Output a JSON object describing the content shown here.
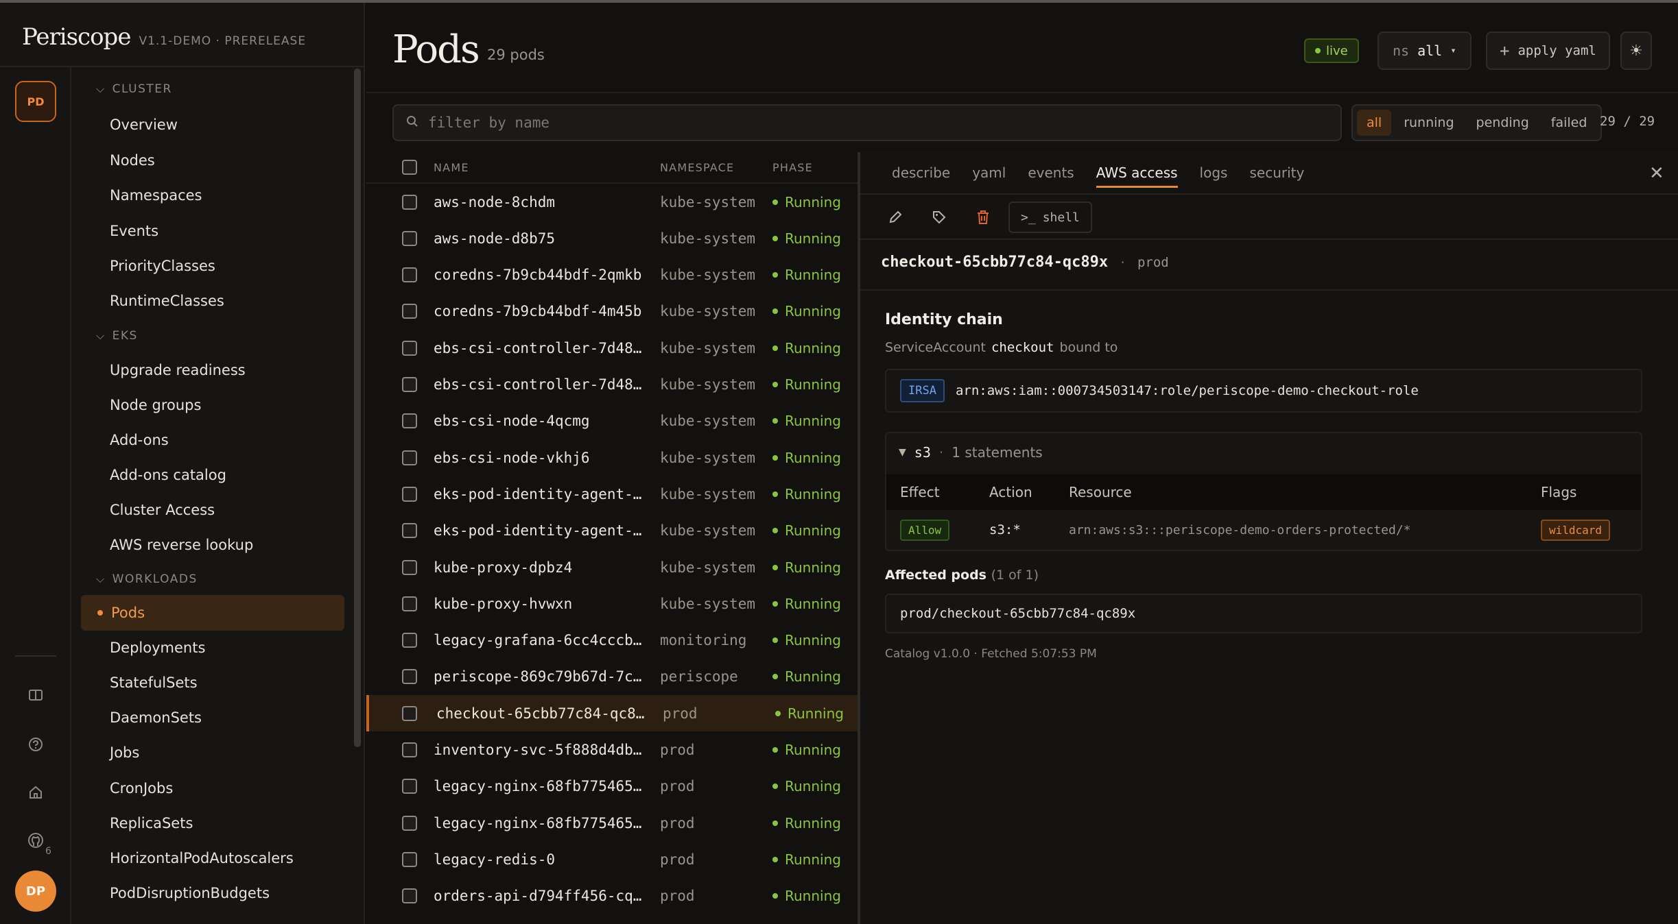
{
  "app": {
    "brand": "Periscope",
    "version": "V1.1-DEMO · PRERELEASE"
  },
  "rail": {
    "context_badge": "PD",
    "github_count": "6",
    "avatar": "DP",
    "icons": [
      "book-icon",
      "help-icon",
      "home-icon",
      "github-icon"
    ]
  },
  "nav": {
    "sections": [
      {
        "label": "CLUSTER",
        "items": [
          "Overview",
          "Nodes",
          "Namespaces",
          "Events",
          "PriorityClasses",
          "RuntimeClasses"
        ]
      },
      {
        "label": "EKS",
        "items": [
          "Upgrade readiness",
          "Node groups",
          "Add-ons",
          "Add-ons catalog",
          "Cluster Access",
          "AWS reverse lookup"
        ]
      },
      {
        "label": "WORKLOADS",
        "items": [
          "Pods",
          "Deployments",
          "StatefulSets",
          "DaemonSets",
          "Jobs",
          "CronJobs",
          "ReplicaSets",
          "HorizontalPodAutoscalers",
          "PodDisruptionBudgets"
        ]
      }
    ],
    "active": "Pods"
  },
  "header": {
    "title": "Pods",
    "count": "29 pods",
    "live": "live",
    "ns_label": "ns",
    "ns_value": "all",
    "apply": "apply yaml"
  },
  "search": {
    "placeholder": "filter by name"
  },
  "filters": {
    "options": [
      "all",
      "running",
      "pending",
      "failed"
    ],
    "active": "all",
    "pager": "29 / 29"
  },
  "table": {
    "headers": {
      "name": "NAME",
      "namespace": "NAMESPACE",
      "phase": "PHASE"
    },
    "rows": [
      {
        "name": "aws-node-8chdm",
        "ns": "kube-system",
        "phase": "Running"
      },
      {
        "name": "aws-node-d8b75",
        "ns": "kube-system",
        "phase": "Running"
      },
      {
        "name": "coredns-7b9cb44bdf-2qmkb",
        "ns": "kube-system",
        "phase": "Running"
      },
      {
        "name": "coredns-7b9cb44bdf-4m45b",
        "ns": "kube-system",
        "phase": "Running"
      },
      {
        "name": "ebs-csi-controller-7d48…",
        "ns": "kube-system",
        "phase": "Running"
      },
      {
        "name": "ebs-csi-controller-7d48…",
        "ns": "kube-system",
        "phase": "Running"
      },
      {
        "name": "ebs-csi-node-4qcmg",
        "ns": "kube-system",
        "phase": "Running"
      },
      {
        "name": "ebs-csi-node-vkhj6",
        "ns": "kube-system",
        "phase": "Running"
      },
      {
        "name": "eks-pod-identity-agent-…",
        "ns": "kube-system",
        "phase": "Running"
      },
      {
        "name": "eks-pod-identity-agent-…",
        "ns": "kube-system",
        "phase": "Running"
      },
      {
        "name": "kube-proxy-dpbz4",
        "ns": "kube-system",
        "phase": "Running"
      },
      {
        "name": "kube-proxy-hvwxn",
        "ns": "kube-system",
        "phase": "Running"
      },
      {
        "name": "legacy-grafana-6cc4cccb…",
        "ns": "monitoring",
        "phase": "Running"
      },
      {
        "name": "periscope-869c79b67d-7c…",
        "ns": "periscope",
        "phase": "Running"
      },
      {
        "name": "checkout-65cbb77c84-qc8…",
        "ns": "prod",
        "phase": "Running",
        "selected": true
      },
      {
        "name": "inventory-svc-5f888d4db…",
        "ns": "prod",
        "phase": "Running"
      },
      {
        "name": "legacy-nginx-68fb775465…",
        "ns": "prod",
        "phase": "Running"
      },
      {
        "name": "legacy-nginx-68fb775465…",
        "ns": "prod",
        "phase": "Running"
      },
      {
        "name": "legacy-redis-0",
        "ns": "prod",
        "phase": "Running"
      },
      {
        "name": "orders-api-d794ff456-cq…",
        "ns": "prod",
        "phase": "Running"
      }
    ]
  },
  "detail": {
    "tabs": [
      "describe",
      "yaml",
      "events",
      "AWS access",
      "logs",
      "security"
    ],
    "active_tab": "AWS access",
    "shell": "shell",
    "pod_name": "checkout-65cbb77c84-qc89x",
    "pod_sep": "·",
    "pod_ns": "prod",
    "identity_title": "Identity chain",
    "sa_prefix": "ServiceAccount",
    "sa_name": "checkout",
    "sa_suffix": "bound to",
    "irsa_badge": "IRSA",
    "role_arn": "arn:aws:iam::000734503147:role/periscope-demo-checkout-role",
    "policy": {
      "service": "s3",
      "sep": "·",
      "statements": "1 statements",
      "headers": {
        "effect": "Effect",
        "action": "Action",
        "resource": "Resource",
        "flags": "Flags"
      },
      "row": {
        "effect": "Allow",
        "action": "s3:*",
        "resource": "arn:aws:s3:::periscope-demo-orders-protected/*",
        "flag": "wildcard"
      }
    },
    "affected_title": "Affected pods",
    "affected_count": "(1 of 1)",
    "affected_pod": "prod/checkout-65cbb77c84-qc89x",
    "catalog": "Catalog v1.0.0 · Fetched 5:07:53 PM"
  },
  "colors": {
    "accent": "#e98936",
    "running": "#8bc540",
    "danger": "#e2622b",
    "background": "#121110"
  }
}
